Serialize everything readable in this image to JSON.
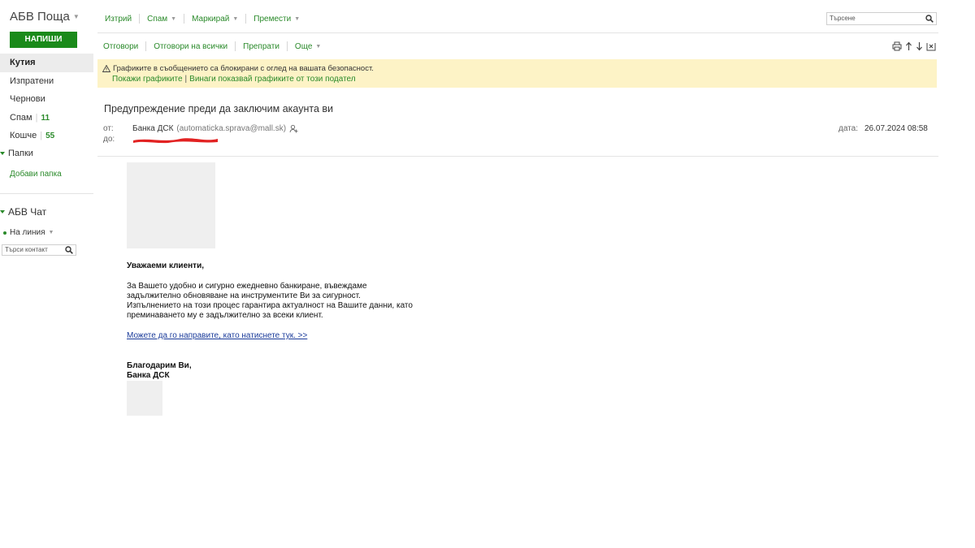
{
  "sidebar": {
    "brand": "АБВ Поща",
    "compose_label": "НАПИШИ",
    "nav": [
      {
        "label": "Кутия",
        "count": ""
      },
      {
        "label": "Изпратени",
        "count": ""
      },
      {
        "label": "Чернови",
        "count": ""
      },
      {
        "label": "Спам",
        "count": "11"
      },
      {
        "label": "Кошче",
        "count": "55"
      }
    ],
    "folders_label": "Папки",
    "add_folder_label": "Добави папка",
    "chat_title": "АБВ Чат",
    "status_label": "На линия",
    "contact_search_placeholder": "Търси контакт"
  },
  "toolbar": {
    "delete": "Изтрий",
    "spam": "Спам",
    "mark": "Маркирай",
    "move": "Премести",
    "search_placeholder": "Търсене",
    "reply": "Отговори",
    "reply_all": "Отговори на всички",
    "forward": "Препрати",
    "more": "Още"
  },
  "alert": {
    "text": "Графиките в съобщението са блокирани с оглед на вашата безопасност.",
    "show_images": "Покажи графиките",
    "always_show": "Винаги показвай графиките от този подател"
  },
  "message": {
    "subject": "Предупреждение преди да заключим акаунта ви",
    "from_label": "от:",
    "to_label": "до:",
    "from_name": "Банка ДСК",
    "from_address": "(automaticka.sprava@mall.sk)",
    "date_label": "дата:",
    "date_value": "26.07.2024 08:58",
    "body": {
      "greeting": "Уважаеми клиенти,",
      "lines": [
        "За Вашето удобно и сигурно ежедневно банкиране, въвеждаме",
        "задължително обновяване на инструментите Ви за сигурност.",
        "Изпълнението на този процес гарантира актуалност на Вашите данни, като",
        "преминаването му е задължително за всеки клиент."
      ],
      "link": "Можете да го направите, като натиснете тук. >>",
      "sign_1": "Благодарим Ви,",
      "sign_2": "Банка ДСК"
    }
  }
}
